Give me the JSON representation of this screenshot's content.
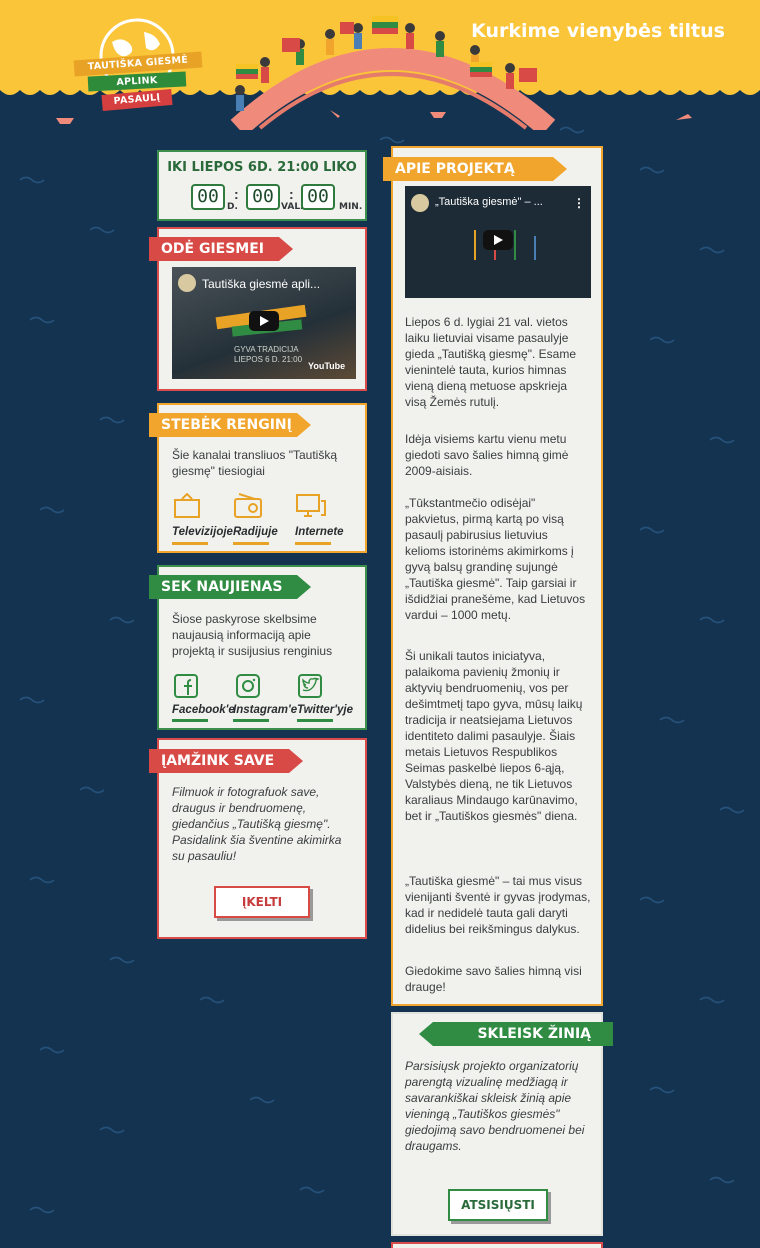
{
  "header": {
    "tagline": "Kurkime vienybės tiltus",
    "logo": {
      "line1": "TAUTIŠKA GIESMĖ",
      "line2": "APLINK",
      "line3": "PASAULĮ"
    }
  },
  "countdown": {
    "title": "IKI LIEPOS 6D. 21:00 LIKO",
    "days": "00",
    "days_unit": "D.",
    "hours": "00",
    "hours_unit": "VAL.",
    "minutes": "00",
    "minutes_unit": "MIN."
  },
  "ode": {
    "heading": "ODĖ GIESMEI",
    "video_title": "Tautiška giesmė apli...",
    "video_caption1": "GYVA TRADICIJA",
    "video_caption2": "LIEPOS 6 D. 21:00",
    "youtube_label": "YouTube"
  },
  "watch": {
    "heading": "STEBĖK RENGINĮ",
    "text": "Šie kanalai transliuos \"Tautišką giesmę\" tiesiogiai",
    "channels": [
      {
        "label": "Televizijoje",
        "icon": "tv-icon"
      },
      {
        "label": "Radijuje",
        "icon": "radio-icon"
      },
      {
        "label": "Internete",
        "icon": "computer-icon"
      }
    ]
  },
  "news": {
    "heading": "SEK NAUJIENAS",
    "text": "Šiose paskyrose skelbsime naujausią informaciją apie projektą ir susijusius renginius",
    "channels": [
      {
        "label": "Facebook'e",
        "icon": "facebook-icon"
      },
      {
        "label": "Instagram'e",
        "icon": "instagram-icon"
      },
      {
        "label": "Twitter'yje",
        "icon": "twitter-icon"
      }
    ]
  },
  "immortalize": {
    "heading": "ĮAMŽINK SAVE",
    "text": "Filmuok ir fotografuok save, draugus ir bendruomenę, giedančius „Tautišką giesmę\". Pasidalink šia šventine akimirka su pasauliu!",
    "button": "ĮKELTI"
  },
  "about": {
    "heading": "APIE PROJEKTĄ",
    "video_title": "„Tautiška giesmė\" – ...",
    "paragraphs": [
      "Liepos 6 d. lygiai 21 val. vietos laiku lietuviai visame pasaulyje gieda „Tautišką giesmę\". Esame vienintelė tauta, kurios himnas vieną dieną metuose apskrieja visą Žemės rutulį.",
      "Idėja visiems kartu vienu metu giedoti savo šalies himną gimė 2009-aisiais.",
      "„Tūkstantmečio odisėjai\" pakvietus, pirmą kartą po visą pasaulį pabirusius lietuvius kelioms istorinėms akimirkoms į gyvą balsų grandinę sujungė „Tautiška giesmė\". Taip garsiai ir išdidžiai pranešėme, kad Lietuvos vardui – 1000 metų.",
      "Ši unikali tautos iniciatyva, palaikoma pavienių žmonių ir aktyvių bendruomenių, vos per dešimtmetį tapo gyva, mūsų laikų tradicija ir neatsiejama Lietuvos identiteto dalimi pasaulyje. Šiais metais Lietuvos Respublikos Seimas paskelbė liepos 6-ąją, Valstybės dieną, ne tik Lietuvos karaliaus Mindaugo karūnavimo, bet ir „Tautiškos giesmės\" diena.",
      "„Tautiška giesmė\" – tai mus visus vienijanti šventė ir gyvas įrodymas, kad ir nedidelė tauta gali daryti didelius bei reikšmingus dalykus.",
      "Giedokime savo šalies himną visi drauge!"
    ]
  },
  "spread": {
    "heading": "SKLEISK ŽINIĄ",
    "text": "Parsisiųsk projekto organizatorių parengtą vizualinę medžiagą ir savarankiškai skleisk žinią apie vieningą „Tautiškos giesmės\" giedojimą savo bendruomenei bei draugams.",
    "button": "ATSISIŲSTI"
  },
  "colors": {
    "navy": "#143350",
    "yellow": "#fbc53a",
    "green": "#2f8c42",
    "red": "#d84a46",
    "orange": "#f1a52c"
  }
}
